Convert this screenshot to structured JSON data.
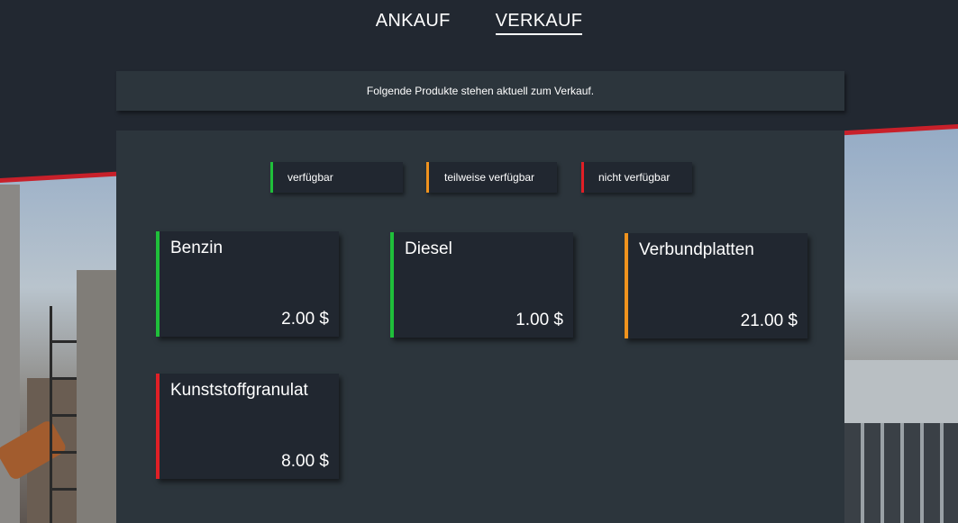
{
  "nav": {
    "tabs": [
      {
        "label": "ANKAUF",
        "active": false
      },
      {
        "label": "VERKAUF",
        "active": true
      }
    ]
  },
  "banner": {
    "text": "Folgende Produkte stehen aktuell zum Verkauf."
  },
  "legend": [
    {
      "label": "verfügbar",
      "color": "#1fbf3a"
    },
    {
      "label": "teilweise verfügbar",
      "color": "#f0931e"
    },
    {
      "label": "nicht verfügbar",
      "color": "#e01f26"
    }
  ],
  "products": [
    {
      "name": "Benzin",
      "price": "2.00 $",
      "status": "verfügbar",
      "color": "#1fbf3a"
    },
    {
      "name": "Diesel",
      "price": "1.00 $",
      "status": "verfügbar",
      "color": "#1fbf3a"
    },
    {
      "name": "Verbundplatten",
      "price": "21.00 $",
      "status": "teilweise verfügbar",
      "color": "#f0931e"
    },
    {
      "name": "Kunststoffgranulat",
      "price": "8.00 $",
      "status": "nicht verfügbar",
      "color": "#e01f26"
    }
  ]
}
